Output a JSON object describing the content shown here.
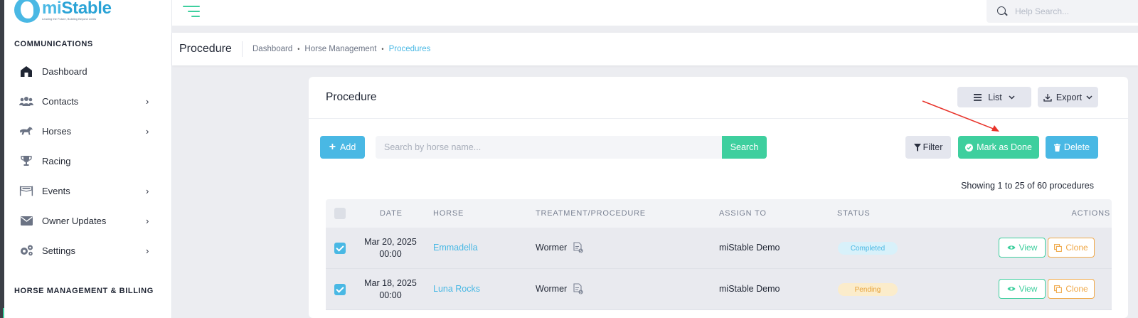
{
  "brand": {
    "name_mi": "mi",
    "name_rest": "Stable",
    "tagline": "Leading the Future, Building Beyond Limits"
  },
  "sidebar": {
    "section1": "COMMUNICATIONS",
    "items": [
      {
        "label": "Dashboard",
        "icon": "home-icon",
        "chevron": false
      },
      {
        "label": "Contacts",
        "icon": "users-icon",
        "chevron": true
      },
      {
        "label": "Horses",
        "icon": "horse-icon",
        "chevron": true
      },
      {
        "label": "Racing",
        "icon": "trophy-icon",
        "chevron": false
      },
      {
        "label": "Events",
        "icon": "banner-icon",
        "chevron": true
      },
      {
        "label": "Owner Updates",
        "icon": "envelope-icon",
        "chevron": true
      },
      {
        "label": "Settings",
        "icon": "gears-icon",
        "chevron": true
      }
    ],
    "section2": "HORSE MANAGEMENT & BILLING",
    "chevron_glyph": "›"
  },
  "topbar": {
    "help_placeholder": "Help Search..."
  },
  "header": {
    "title": "Procedure",
    "breadcrumb": [
      "Dashboard",
      "Horse Management",
      "Procedures"
    ],
    "separator": "•"
  },
  "card": {
    "title": "Procedure",
    "view_label": "List",
    "export_label": "Export",
    "add_label": "Add",
    "search_placeholder": "Search by horse name...",
    "search_label": "Search",
    "filter_label": "Filter",
    "mark_done_label": "Mark as Done",
    "delete_label": "Delete",
    "showing": "Showing 1 to 25 of 60 procedures"
  },
  "table": {
    "headers": {
      "date": "DATE",
      "horse": "HORSE",
      "treatment": "TREATMENT/PROCEDURE",
      "assign": "ASSIGN TO",
      "status": "STATUS",
      "actions": "ACTIONS"
    },
    "rows": [
      {
        "date": "Mar 20, 2025",
        "time": "00:00",
        "horse": "Emmadella",
        "treatment": "Wormer",
        "assign": "miStable Demo",
        "status": "Completed",
        "status_color": "#49b8e4",
        "checked": true
      },
      {
        "date": "Mar 18, 2025",
        "time": "00:00",
        "horse": "Luna Rocks",
        "treatment": "Wormer",
        "assign": "miStable Demo",
        "status": "Pending",
        "status_color": "#e7a339",
        "checked": true
      }
    ],
    "view_label": "View",
    "clone_label": "Clone"
  },
  "colors": {
    "accent_blue": "#49b8e4",
    "accent_green": "#3ecf9e",
    "annotation_red": "#e8332a"
  }
}
